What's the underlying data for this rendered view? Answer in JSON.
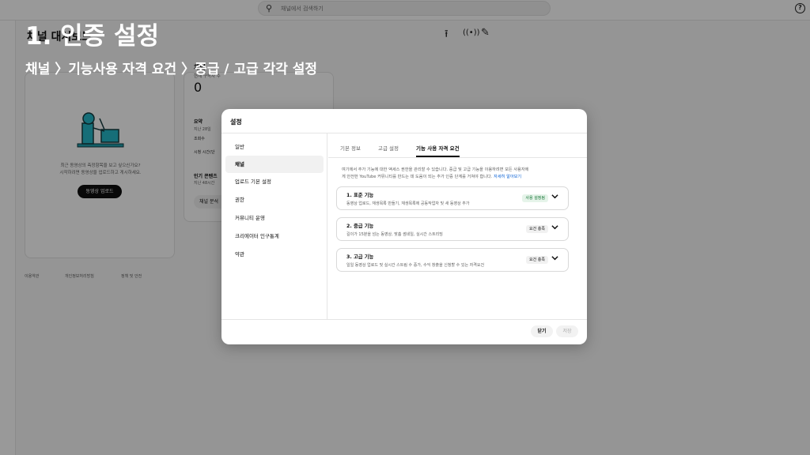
{
  "overlay": {
    "title": "1. 인증 설정",
    "subtitle": "채널 〉기능사용 자격 요건 〉중급 / 고급 각각 설정"
  },
  "background": {
    "search_placeholder": "채널에서 검색하기",
    "page_title": "채널 대시보드",
    "upload_card": {
      "promo_line1": "최근 동영상의 측정항목을 보고 싶으신가요?",
      "promo_line2": "시작하려면 동영상을 업로드하고 게시하세요.",
      "upload_button": "동영상 업로드"
    },
    "analytics_card": {
      "title": "채널",
      "subscribers_label": "현재 구독자 수",
      "subscribers_value": "0",
      "summary_title": "요약",
      "summary_period": "지난 28일",
      "views_label": "조회수",
      "watch_time_label": "시청 시간(단",
      "popular_title": "인기 콘텐츠",
      "popular_period": "지난 48시간",
      "analytics_button": "채널 분석"
    },
    "footer": [
      "이용약관",
      "개인정보처리방침",
      "정책 및 안전"
    ]
  },
  "modal": {
    "title": "설정",
    "nav": [
      {
        "label": "일반",
        "active": false
      },
      {
        "label": "채널",
        "active": true
      },
      {
        "label": "업로드 기본 설정",
        "active": false
      },
      {
        "label": "권한",
        "active": false
      },
      {
        "label": "커뮤니티 운영",
        "active": false
      },
      {
        "label": "크리에이터 인구통계",
        "active": false
      },
      {
        "label": "약관",
        "active": false
      }
    ],
    "tabs": [
      {
        "label": "기본 정보",
        "active": false
      },
      {
        "label": "고급 설정",
        "active": false
      },
      {
        "label": "기능 사용 자격 요건",
        "active": true
      }
    ],
    "description_line1": "여기에서 추가 기능에 대한 액세스 권한을 관리할 수 있습니다. 중급 및 고급 기능을 이용하려면 모든 사용자에",
    "description_line2": "게 안전한 YouTube 커뮤니티를 만드는 데 도움이 되는 추가 인증 단계를 거쳐야 합니다.",
    "learn_more": "자세히 알아보기",
    "features": [
      {
        "title": "1. 표준 기능",
        "desc": "동영상 업로드, 재생목록 만들기, 재생목록에 공동작업자 및 새 동영상 추가",
        "badge": "사용 설정됨",
        "badge_type": "ok"
      },
      {
        "title": "2. 중급 기능",
        "desc": "길이가 15분을 넘는 동영상, 맞춤 썸네일, 실시간 스트리밍",
        "badge": "요건 충족",
        "badge_type": "req"
      },
      {
        "title": "3. 고급 기능",
        "desc": "일일 동영상 업로드 및 실시간 스트림 수 증가, 수익 창출을 신청할 수 있는 자격요건",
        "badge": "요건 충족",
        "badge_type": "req"
      }
    ],
    "close_button": "닫기",
    "save_button": "저장"
  },
  "colors": {
    "accent_link": "#065fd4",
    "badge_ok_bg": "#e6f4ea",
    "badge_ok_text": "#137333",
    "overlay_text": "#ffffff"
  }
}
